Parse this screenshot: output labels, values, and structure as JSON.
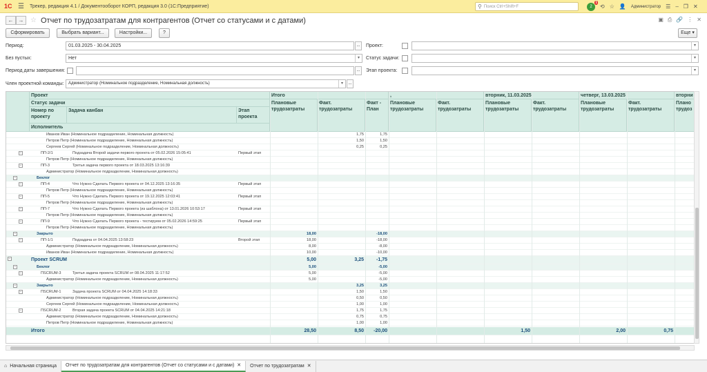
{
  "app": {
    "logo": "1С",
    "title": "Трекер, редакция 4.1 / Документооборот КОРП, редакция 3.0  (1С:Предприятие)",
    "search_placeholder": "Поиск Ctrl+Shift+F",
    "badge_count": "2",
    "notif": "1",
    "user": "Администратор"
  },
  "header": {
    "title": "Отчет по трудозатратам для контрагентов (Отчет со статусами и с датами)",
    "more": "Еще"
  },
  "toolbar": {
    "generate": "Сформировать",
    "variant": "Выбрать вариант...",
    "settings": "Настройки...",
    "help": "?"
  },
  "filters": {
    "period_label": "Период:",
    "period_value": "01.03.2025 - 30.04.2025",
    "empty_label": "Без пустых:",
    "empty_value": "Нет",
    "finish_label": "Период даты завершения:",
    "member_label": "Член проектной команды:",
    "member_value": "Администратор (Номинальное подразделение, Номинальная должность)",
    "project_label": "Проект:",
    "status_label": "Статус задачи:",
    "stage_label": "Этап проекта:"
  },
  "columns": {
    "project": "Проект",
    "status": "Статус задачи",
    "number": "Номер по проекту",
    "task": "Задача канбан",
    "stage": "Этап проекта",
    "executor": "Исполнитель",
    "total": "Итого",
    "date1": "вторник, 11.03.2025",
    "date2": "четверг, 13.03.2025",
    "date3": "вторни",
    "comma": ",",
    "plan": "Плановые трудозатраты",
    "fact": "Факт. трудозатраты",
    "diff": "Факт - План",
    "plan_short": "Плано трудоз"
  },
  "rows": [
    {
      "t": "p",
      "name": "Иванов Иван (Номинальное подразделение, Номинальная должность)",
      "fact": "1,75",
      "diff": "1,75"
    },
    {
      "t": "p",
      "name": "Петров Петр (Номинальное подразделение, Номинальная должность)",
      "fact": "1,50",
      "diff": "1,50"
    },
    {
      "t": "p",
      "name": "Сергеев Сергей (Номинальное подразделение, Номинальная должность)",
      "fact": "0,25",
      "diff": "0,25"
    },
    {
      "t": "k",
      "num": "ПП-2/1",
      "task": "Подзадача Второй задачи первого проекта от 05.02.2026 15:05:41",
      "stage": "Первый этап"
    },
    {
      "t": "p",
      "name": "Петров Петр (Номинальное подразделение, Номинальная должность)"
    },
    {
      "t": "k",
      "num": "ПП-3",
      "task": "Третья задача первого проекта от 18.03.2025 13:16:39",
      "stage": ""
    },
    {
      "t": "p",
      "name": "Администратор (Номинальное подразделение, Номинальная должность)"
    },
    {
      "t": "s",
      "name": "Беклог"
    },
    {
      "t": "k",
      "num": "ПП-4",
      "task": "Что Нужно Сделать Первого проекта от 04.12.2025 13:16:35",
      "stage": "Первый этап"
    },
    {
      "t": "p",
      "name": "Петров Петр (Номинальное подразделение, Номинальная должность)"
    },
    {
      "t": "k",
      "num": "ПП-5",
      "task": "Что Нужно Сделать Первого проекта от 19.12.2025 12:03:41",
      "stage": "Первый этап"
    },
    {
      "t": "p",
      "name": "Петров Петр (Номинальное подразделение, Номинальная должность)"
    },
    {
      "t": "k",
      "num": "ПП-7",
      "task": "Что Нужно Сделать Первого проекта (из шаблона) от 13.01.2026 10:53:17",
      "stage": "Первый этап"
    },
    {
      "t": "p",
      "name": "Петров Петр (Номинальное подразделение, Номинальная должность)"
    },
    {
      "t": "k",
      "num": "ПП-9",
      "task": "Что Нужно Сделать Первого проекта - тестируем от 05.02.2026 14:59:25",
      "stage": "Первый этап"
    },
    {
      "t": "p",
      "name": "Петров Петр (Номинальное подразделение, Номинальная должность)"
    },
    {
      "t": "s",
      "name": "Закрыто",
      "plan": "18,00",
      "diff": "-18,00"
    },
    {
      "t": "k",
      "num": "ПП-1/1",
      "task": "Подзадача от 04.04.2025 13:58:23",
      "stage": "Второй этап",
      "plan": "18,00",
      "diff": "-18,00"
    },
    {
      "t": "p",
      "name": "Администратор (Номинальное подразделение, Номинальная должность)",
      "plan": "8,00",
      "diff": "-8,00"
    },
    {
      "t": "p",
      "name": "Иванов Иван (Номинальное подразделение, Номинальная должность)",
      "plan": "10,00",
      "diff": "-10,00"
    },
    {
      "t": "P",
      "name": "Проект SCRUM",
      "plan": "5,00",
      "fact": "3,25",
      "diff": "-1,75"
    },
    {
      "t": "s",
      "name": "Беклог",
      "plan": "5,00",
      "diff": "-5,00"
    },
    {
      "t": "k",
      "num": "ПSCRUM-3",
      "task": "Третья задача проекта SCRUM от 08.04.2025 11:17:52",
      "stage": "",
      "plan": "5,00",
      "diff": "-5,00"
    },
    {
      "t": "p",
      "name": "Администратор (Номинальное подразделение, Номинальная должность)",
      "plan": "5,00",
      "diff": "-5,00"
    },
    {
      "t": "s",
      "name": "Закрыто",
      "fact": "3,25",
      "diff": "3,25"
    },
    {
      "t": "k",
      "num": "ПSCRUM-1",
      "task": "Задача проекта SCRUM от 04.04.2025 14:18:33",
      "stage": "",
      "fact": "1,50",
      "diff": "1,50"
    },
    {
      "t": "p",
      "name": "Администратор (Номинальное подразделение, Номинальная должность)",
      "fact": "0,50",
      "diff": "0,50"
    },
    {
      "t": "p",
      "name": "Сергеев Сергей (Номинальное подразделение, Номинальная должность)",
      "fact": "1,00",
      "diff": "1,00"
    },
    {
      "t": "k",
      "num": "ПSCRUM-2",
      "task": "Вторая задача проекта SCRUM от 04.04.2025 14:21:18",
      "stage": "",
      "fact": "1,75",
      "diff": "1,75"
    },
    {
      "t": "p",
      "name": "Администратор (Номинальное подразделение, Номинальная должность)",
      "fact": "0,75",
      "diff": "0,75"
    },
    {
      "t": "p",
      "name": "Петров Петр (Номинальное подразделение, Номинальная должность)",
      "fact": "1,00",
      "diff": "1,00"
    }
  ],
  "total": {
    "label": "Итого",
    "plan": "28,50",
    "fact": "8,50",
    "diff": "-20,00",
    "d1_fact": "1,50",
    "d2_plan": "2,00",
    "d2_fact": "0,75"
  },
  "tabs": {
    "home": "Начальная страница",
    "tab1": "Отчет по трудозатратам для контрагентов (Отчет со статусами и с датами)",
    "tab2": "Отчет по трудозатратам"
  }
}
